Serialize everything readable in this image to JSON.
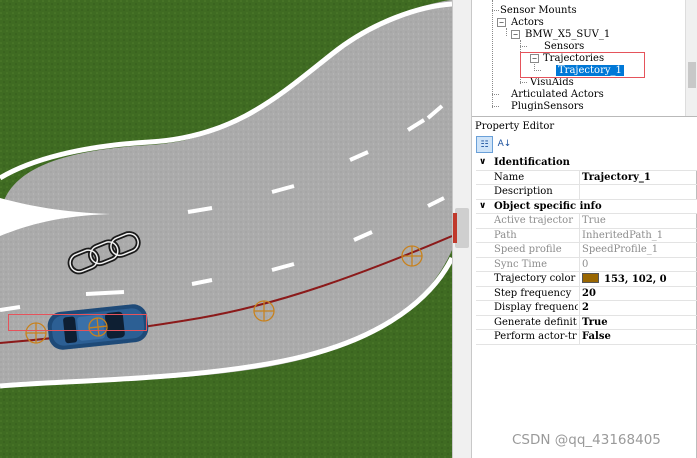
{
  "tree": {
    "items": [
      {
        "label": "Sensor Mounts"
      },
      {
        "label": "Actors"
      },
      {
        "label": "BMW_X5_SUV_1"
      },
      {
        "label": "Sensors"
      },
      {
        "label": "Trajectories"
      },
      {
        "label": "Trajectory_1"
      },
      {
        "label": "VisuAids"
      },
      {
        "label": "Articulated Actors"
      },
      {
        "label": "PluginSensors"
      }
    ]
  },
  "property_editor": {
    "title": "Property Editor",
    "categories": [
      {
        "label": "Identification",
        "rows": [
          {
            "name": "Name",
            "value": "Trajectory_1"
          },
          {
            "name": "Description",
            "value": ""
          }
        ]
      },
      {
        "label": "Object specific info",
        "rows": [
          {
            "name": "Active trajector",
            "value": "True"
          },
          {
            "name": "Path",
            "value": "InheritedPath_1"
          },
          {
            "name": "Speed profile",
            "value": "SpeedProfile_1"
          },
          {
            "name": "Sync Time",
            "value": "0"
          },
          {
            "name": "Trajectory color",
            "value": "153, 102, 0",
            "color": "#996600"
          },
          {
            "name": "Step frequency",
            "value": "20"
          },
          {
            "name": "Display frequenc",
            "value": "2"
          },
          {
            "name": "Generate definit",
            "value": "True"
          },
          {
            "name": "Perform actor-tr",
            "value": "False"
          }
        ]
      }
    ]
  },
  "colors": {
    "selection": "#0078d7",
    "highlight_box": "#e5535b",
    "trajectory": "#8b1a1a",
    "grass": "#3f6b22",
    "road": "#a9a9a9"
  },
  "watermark": "CSDN @qq_43168405"
}
